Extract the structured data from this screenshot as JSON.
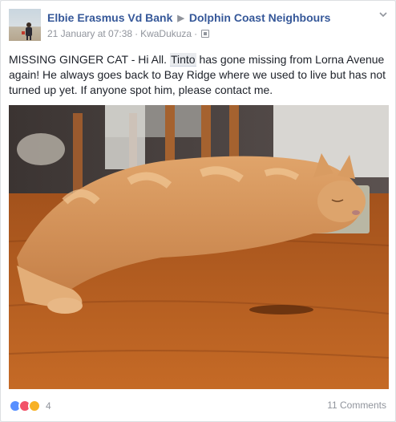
{
  "post": {
    "author": "Elbie Erasmus Vd Bank",
    "group": "Dolphin Coast Neighbours",
    "timestamp": "21 January at 07:38",
    "location": "KwaDukuza",
    "text_before_tag": "MISSING GINGER CAT - Hi All. ",
    "tag": "Tinto",
    "text_after_tag": " has gone missing from Lorna Avenue again! He always goes back to Bay Ridge where we used to live but has not turned up yet. If anyone spot him, please contact me.",
    "photo_subject": "ginger tabby cat lying on wooden table"
  },
  "footer": {
    "reaction_count": "4",
    "reactions": [
      "like",
      "love",
      "wow"
    ],
    "comments_label": "11 Comments"
  },
  "icons": {
    "header_menu": "chevron-down-icon",
    "audience": "group-audience-icon",
    "separator": "triangle-right-icon"
  },
  "colors": {
    "link": "#365899",
    "meta": "#90949c",
    "like": "#5890ff",
    "love": "#f25268",
    "wow": "#f7b125"
  }
}
